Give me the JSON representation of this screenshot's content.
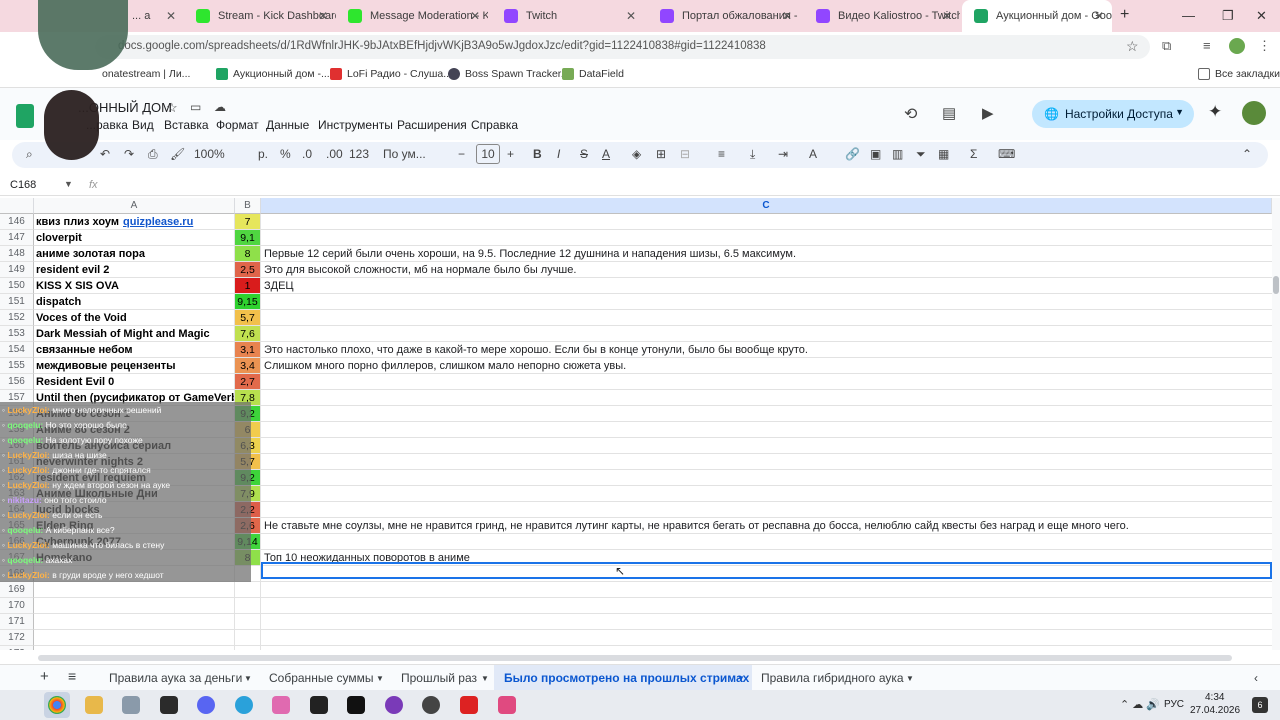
{
  "browser": {
    "tabs": [
      {
        "label": "... a"
      },
      {
        "label": "Stream - Kick Dashboard"
      },
      {
        "label": "Message Moderation - Ki"
      },
      {
        "label": "Twitch"
      },
      {
        "label": "Портал обжалования - T"
      },
      {
        "label": "Видео Kaliostroo - Twitch"
      },
      {
        "label": "Аукционный дом - Goo"
      }
    ],
    "url": "docs.google.com/spreadsheets/d/1RdWfnlrJHK-9bJAtxBEfHjdjvWKjB3A9o5wJgdoxJzc/edit?gid=1122410838#gid=1122410838",
    "bookmarks": [
      "onatestream | Ли...",
      "Аукционный дом -...",
      "LoFi Радио - Слуша...",
      "Boss Spawn Tracker...",
      "DataField"
    ],
    "all_bookmarks": "Все закладки"
  },
  "sheets": {
    "doc_title": "...ОННЫЙ ДОМ",
    "menu": [
      "...равка",
      "Вид",
      "Вставка",
      "Формат",
      "Данные",
      "Инструменты",
      "Расширения",
      "Справка"
    ],
    "share_label": "Настройки Доступа",
    "toolbar": {
      "zoom": "100%",
      "currency": "р.",
      "percent": "%",
      "dec_less": ".0",
      "dec_more": ".00",
      "num_format": "123",
      "font": "По ум...",
      "font_size": "10"
    },
    "name_box": "C168",
    "fx": "fx"
  },
  "columns": [
    "A",
    "B",
    "C"
  ],
  "rows": [
    {
      "n": "146",
      "a": "квиз плиз хоум",
      "link": "quizplease.ru",
      "b": "7",
      "color": "#e6e65c",
      "c": ""
    },
    {
      "n": "147",
      "a": "cloverpit",
      "b": "9,1",
      "color": "#4fd641",
      "c": ""
    },
    {
      "n": "148",
      "a": "аниме золотая пора",
      "b": "8",
      "color": "#8fe04a",
      "c": "Первые 12 серий были очень хороши, на 9.5. Последние 12 душнина и нападения шизы, 6.5 максимум."
    },
    {
      "n": "149",
      "a": "resident evil 2",
      "b": "2,5",
      "color": "#e0654a",
      "c": "Это для высокой сложности, мб на нормале было бы лучше."
    },
    {
      "n": "150",
      "a": "KISS X SIS OVA",
      "b": "1",
      "color": "#d91c1c",
      "c": "ЗДЕЦ"
    },
    {
      "n": "151",
      "a": "dispatch",
      "b": "9,15",
      "color": "#2ed12e",
      "c": ""
    },
    {
      "n": "152",
      "a": "Voces of the Void",
      "b": "5,7",
      "color": "#f2c04b",
      "c": ""
    },
    {
      "n": "153",
      "a": "Dark Messiah of Might and Magic",
      "b": "7,6",
      "color": "#c0e050",
      "c": ""
    },
    {
      "n": "154",
      "a": "связанные небом",
      "b": "3,1",
      "color": "#e8834f",
      "c": "Это настолько плохо, что даже в какой-то мере хорошо. Если бы в конце утонули, было бы вообще круто."
    },
    {
      "n": "155",
      "a": "междивовые рецензенты",
      "b": "3,4",
      "color": "#eb9352",
      "c": "Слишком много порно филлеров, слишком мало непорно сюжета увы."
    },
    {
      "n": "156",
      "a": "Resident Evil 0",
      "b": "2,7",
      "color": "#e26a4b",
      "c": ""
    },
    {
      "n": "157",
      "a": "Until then (русификатор от GameVerbal)",
      "b": "7,8",
      "color": "#b8e04e",
      "c": ""
    },
    {
      "n": "158",
      "a": "Аниме 86 сезон 1",
      "b": "9,2",
      "color": "#3dd43a",
      "c": ""
    },
    {
      "n": "159",
      "a": "Аниме 86 сезон 2",
      "b": "6",
      "color": "#f2cc4d",
      "c": ""
    },
    {
      "n": "160",
      "a": "воитель анубиса сериал",
      "b": "6,3",
      "color": "#eed24e",
      "c": ""
    },
    {
      "n": "161",
      "a": "neverwinter nights 2",
      "b": "5,7",
      "color": "#f2c04b",
      "c": ""
    },
    {
      "n": "162",
      "a": "resident evil requiem",
      "b": "9,2",
      "color": "#3dd43a",
      "c": ""
    },
    {
      "n": "163",
      "a": "Аниме Школьные Дни",
      "b": "7,9",
      "color": "#b0e04e",
      "c": ""
    },
    {
      "n": "164",
      "a": "lucid blocks",
      "b": "2,2",
      "color": "#de5e49",
      "c": ""
    },
    {
      "n": "165",
      "a": "Elden Ring",
      "b": "2,6",
      "color": "#e0674a",
      "c": "Не ставьте мне соулзы, мне не нравится гринд, не нравится лутинг карты, не нравится бегать от респавна до босса, нелюблю сайд квесты без наград и еще много чего."
    },
    {
      "n": "166",
      "a": "Cyberpunk 2077",
      "b": "9,14",
      "color": "#40d43c",
      "c": ""
    },
    {
      "n": "167",
      "a": "Homekano",
      "b": "8",
      "color": "#8fe04a",
      "c": "Топ 10 неожиданных поворотов в аниме"
    },
    {
      "n": "168",
      "a": "",
      "b": "",
      "color": "#ffffff",
      "c": ""
    },
    {
      "n": "169",
      "a": "",
      "b": "",
      "color": "#ffffff",
      "c": ""
    },
    {
      "n": "170",
      "a": "",
      "b": "",
      "color": "#ffffff",
      "c": ""
    },
    {
      "n": "171",
      "a": "",
      "b": "",
      "color": "#ffffff",
      "c": ""
    },
    {
      "n": "172",
      "a": "",
      "b": "",
      "color": "#ffffff",
      "c": ""
    },
    {
      "n": "173",
      "a": "",
      "b": "",
      "color": "#ffffff",
      "c": ""
    }
  ],
  "chat": [
    {
      "user": "LuckyZloi:",
      "ucolor": "#ffb347",
      "msg": "много нелогичных решений"
    },
    {
      "user": "qooqelu:",
      "ucolor": "#7cfc7c",
      "msg": "Но это хорошо было"
    },
    {
      "user": "qooqelu:",
      "ucolor": "#7cfc7c",
      "msg": "На золотую пору похоже"
    },
    {
      "user": "LuckyZloi:",
      "ucolor": "#ffb347",
      "msg": "шиза на шизе"
    },
    {
      "user": "LuckyZloi:",
      "ucolor": "#ffb347",
      "msg": "джонни где-то спрятался"
    },
    {
      "user": "LuckyZloi:",
      "ucolor": "#ffb347",
      "msg": "ну ждем второй сезон на ауке"
    },
    {
      "user": "nikitazu:",
      "ucolor": "#c9a0ff",
      "msg": "оно того стоило"
    },
    {
      "user": "LuckyZloi:",
      "ucolor": "#ffb347",
      "msg": "если он есть"
    },
    {
      "user": "qooqelu:",
      "ucolor": "#7cfc7c",
      "msg": "А киберпанк все?"
    },
    {
      "user": "LuckyZloi:",
      "ucolor": "#ffb347",
      "msg": "машинка что билась в стену"
    },
    {
      "user": "qooqelu:",
      "ucolor": "#7cfc7c",
      "msg": "ахахах"
    },
    {
      "user": "LuckyZloi:",
      "ucolor": "#ffb347",
      "msg": "в груди вроде у него хедшот"
    }
  ],
  "sheet_tabs": [
    "Правила аука за деньги",
    "Собранные суммы",
    "Прошлый раз",
    "Было просмотрено на прошлых стримах",
    "Правила гибридного аука"
  ],
  "taskbar": {
    "lang": "РУС",
    "time": "4:34",
    "date": "27.04.2026",
    "notif": "6"
  }
}
